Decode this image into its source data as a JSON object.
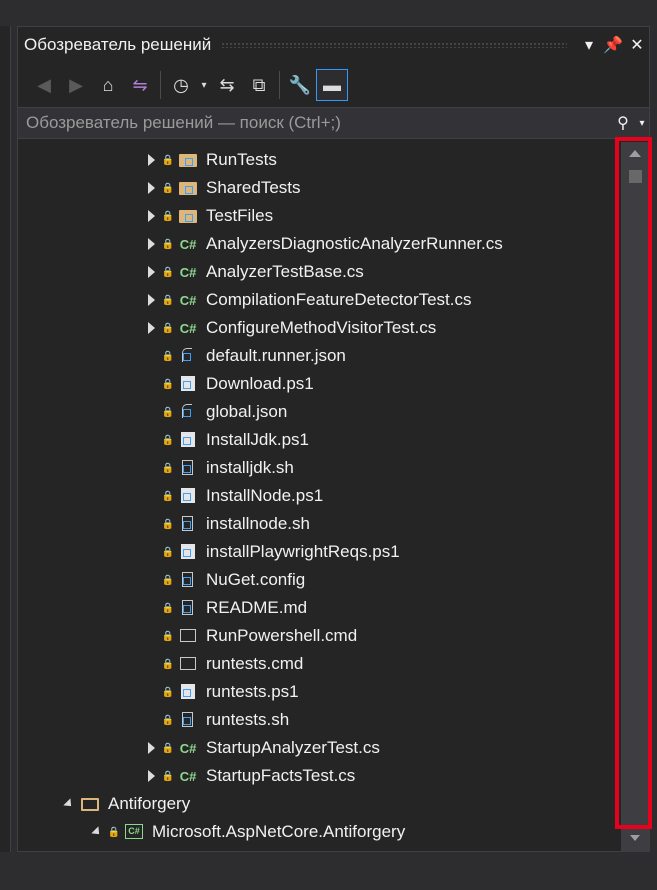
{
  "panel": {
    "title": "Обозреватель решений",
    "search_placeholder": "Обозреватель решений — поиск (Ctrl+;)"
  },
  "title_buttons": [
    "chevron-down-icon",
    "pin-icon",
    "close-icon"
  ],
  "toolbar": [
    {
      "name": "back-icon",
      "glyph": "◀",
      "state": "disabled"
    },
    {
      "name": "forward-icon",
      "glyph": "▶",
      "state": "disabled"
    },
    {
      "name": "home-icon",
      "glyph": "⌂",
      "state": "normal"
    },
    {
      "name": "switch-views-icon",
      "glyph": "⇋",
      "state": "normal"
    },
    {
      "name": "pending-changes-filter-icon",
      "glyph": "◷",
      "state": "normal"
    },
    {
      "name": "sync-active-document-icon",
      "glyph": "⇆",
      "state": "normal"
    },
    {
      "name": "collapse-all-icon",
      "glyph": "⧉",
      "state": "normal"
    },
    {
      "name": "properties-icon",
      "glyph": "🔧",
      "state": "normal"
    },
    {
      "name": "preview-selected-items-icon",
      "glyph": "▬",
      "state": "active"
    }
  ],
  "tree": [
    {
      "label": "RunTests",
      "icon": "folder",
      "expand": "collapsed",
      "lock": true
    },
    {
      "label": "SharedTests",
      "icon": "folder",
      "expand": "collapsed",
      "lock": true
    },
    {
      "label": "TestFiles",
      "icon": "folder",
      "expand": "collapsed",
      "lock": true
    },
    {
      "label": "AnalyzersDiagnosticAnalyzerRunner.cs",
      "icon": "cs",
      "expand": "collapsed",
      "lock": true
    },
    {
      "label": "AnalyzerTestBase.cs",
      "icon": "cs",
      "expand": "collapsed",
      "lock": true
    },
    {
      "label": "CompilationFeatureDetectorTest.cs",
      "icon": "cs",
      "expand": "collapsed",
      "lock": true
    },
    {
      "label": "ConfigureMethodVisitorTest.cs",
      "icon": "cs",
      "expand": "collapsed",
      "lock": true
    },
    {
      "label": "default.runner.json",
      "icon": "json",
      "expand": "none",
      "lock": true
    },
    {
      "label": "Download.ps1",
      "icon": "ps1",
      "expand": "none",
      "lock": true
    },
    {
      "label": "global.json",
      "icon": "json",
      "expand": "none",
      "lock": true
    },
    {
      "label": "InstallJdk.ps1",
      "icon": "ps1",
      "expand": "none",
      "lock": true
    },
    {
      "label": "installjdk.sh",
      "icon": "file",
      "expand": "none",
      "lock": true
    },
    {
      "label": "InstallNode.ps1",
      "icon": "ps1",
      "expand": "none",
      "lock": true
    },
    {
      "label": "installnode.sh",
      "icon": "file",
      "expand": "none",
      "lock": true
    },
    {
      "label": "installPlaywrightReqs.ps1",
      "icon": "ps1",
      "expand": "none",
      "lock": true
    },
    {
      "label": "NuGet.config",
      "icon": "file",
      "expand": "none",
      "lock": true
    },
    {
      "label": "README.md",
      "icon": "file",
      "expand": "none",
      "lock": true
    },
    {
      "label": "RunPowershell.cmd",
      "icon": "cmd",
      "expand": "none",
      "lock": true
    },
    {
      "label": "runtests.cmd",
      "icon": "cmd",
      "expand": "none",
      "lock": true
    },
    {
      "label": "runtests.ps1",
      "icon": "ps1",
      "expand": "none",
      "lock": true
    },
    {
      "label": "runtests.sh",
      "icon": "file",
      "expand": "none",
      "lock": true
    },
    {
      "label": "StartupAnalyzerTest.cs",
      "icon": "cs",
      "expand": "collapsed",
      "lock": true
    },
    {
      "label": "StartupFactsTest.cs",
      "icon": "cs",
      "expand": "collapsed",
      "lock": true
    },
    {
      "label": "Antiforgery",
      "icon": "folder-open",
      "expand": "expanded",
      "lock": false
    },
    {
      "label": "Microsoft.AspNetCore.Antiforgery",
      "icon": "project",
      "expand": "expanded",
      "lock": true
    }
  ],
  "colors": {
    "background": "#252526",
    "accent": "#3399ff",
    "highlight_frame": "#e8001c",
    "folder": "#dcb67a",
    "csharp": "#8ed88e",
    "lock": "#3ea0f7"
  }
}
